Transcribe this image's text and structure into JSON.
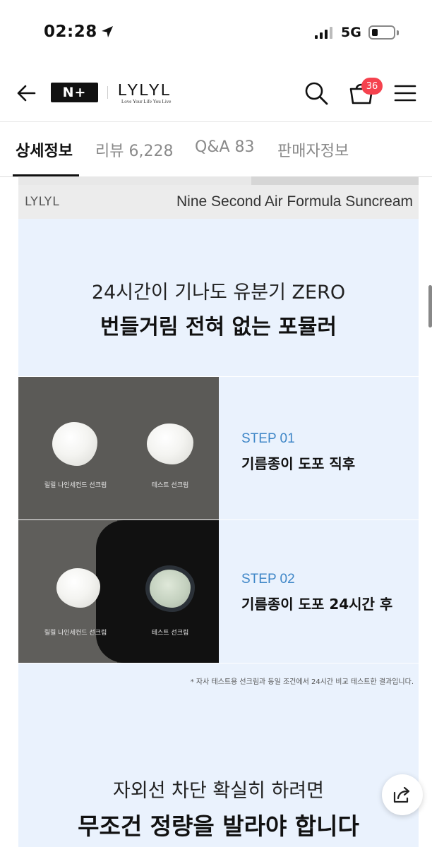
{
  "status_bar": {
    "time": "02:28",
    "network": "5G"
  },
  "header": {
    "logo": "N+",
    "brand": "LYLYL",
    "tagline": "Love Your Life You Live",
    "cart_count": "36"
  },
  "tabs": [
    {
      "label": "상세정보",
      "active": true
    },
    {
      "label": "리뷰 6,228",
      "active": false
    },
    {
      "label": "Q&A 83",
      "active": false
    },
    {
      "label": "판매자정보",
      "active": false
    }
  ],
  "content": {
    "banner_brand": "LYLYL",
    "banner_title": "Nine Second Air Formula Suncream",
    "headline_line1": "24시간이 기나도 유분기 ZERO",
    "headline_line2": "번들거림 전혀 없는 포뮬러",
    "sample_label_left": "릴릴 나인세컨드 선크림",
    "sample_label_right": "테스트 선크림",
    "steps": [
      {
        "label": "STEP 01",
        "desc": "기름종이 도포 직후"
      },
      {
        "label": "STEP 02",
        "desc": "기름종이 도포 24시간 후"
      }
    ],
    "footnote": "* 자사 테스트용 선크림과 동일 조건에서 24시간 비교 테스트한 결과입니다.",
    "sub_line1": "자외선 차단 확실히 하려면",
    "sub_line2": "무조건 정량을 발라야 합니다"
  }
}
